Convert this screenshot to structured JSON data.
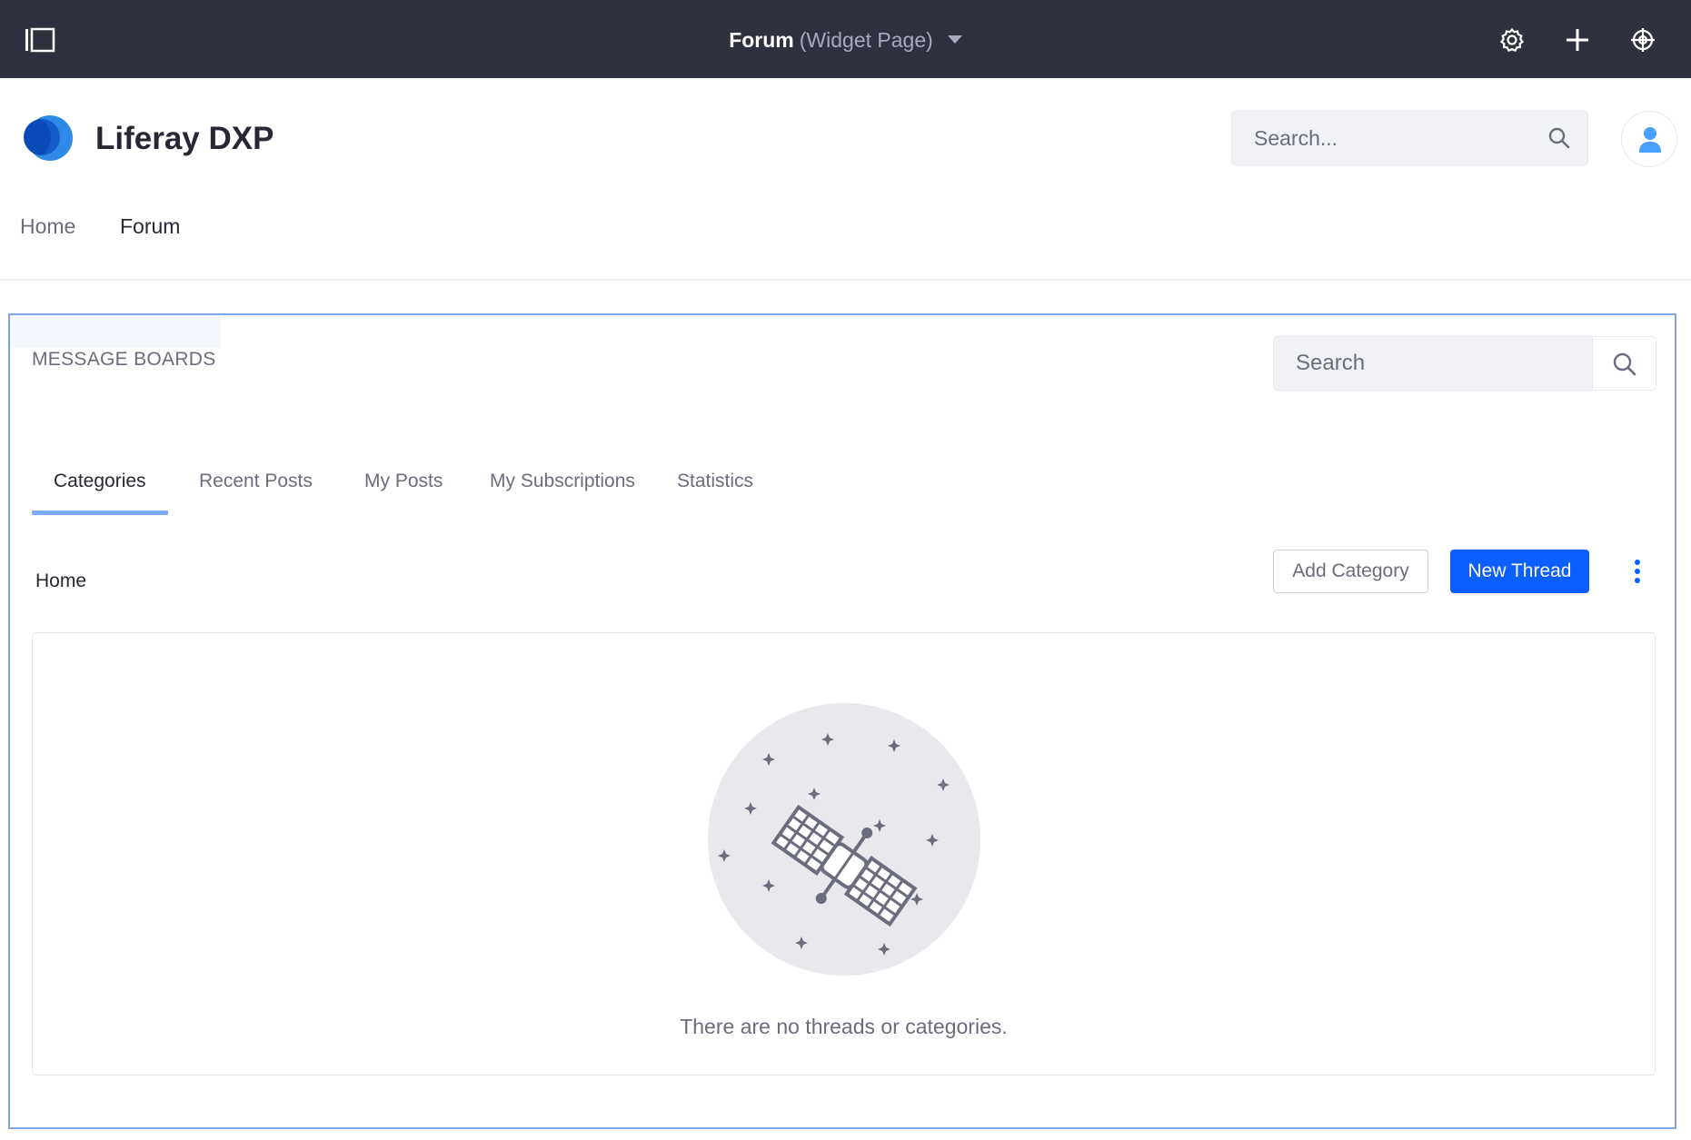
{
  "control_menu": {
    "title": "Forum",
    "subtitle": "(Widget Page)",
    "icons": [
      "sidebar-toggle-icon",
      "gear-icon",
      "plus-icon",
      "simulation-icon"
    ]
  },
  "header": {
    "site_name": "Liferay DXP",
    "search_placeholder": "Search..."
  },
  "nav": {
    "items": [
      {
        "label": "Home"
      },
      {
        "label": "Forum"
      }
    ]
  },
  "portlet": {
    "title": "MESSAGE BOARDS",
    "search_placeholder": "Search",
    "tabs": [
      {
        "label": "Categories",
        "active": true
      },
      {
        "label": "Recent Posts",
        "active": false
      },
      {
        "label": "My Posts",
        "active": false
      },
      {
        "label": "My Subscriptions",
        "active": false
      },
      {
        "label": "Statistics",
        "active": false
      }
    ],
    "breadcrumb": "Home",
    "add_category_label": "Add Category",
    "new_thread_label": "New Thread",
    "empty_message": "There are no threads or categories."
  },
  "colors": {
    "control_menu_bg": "#30313f",
    "primary": "#0b5fff",
    "tab_indicator": "#80acff",
    "portlet_border": "#7ea4ec"
  }
}
